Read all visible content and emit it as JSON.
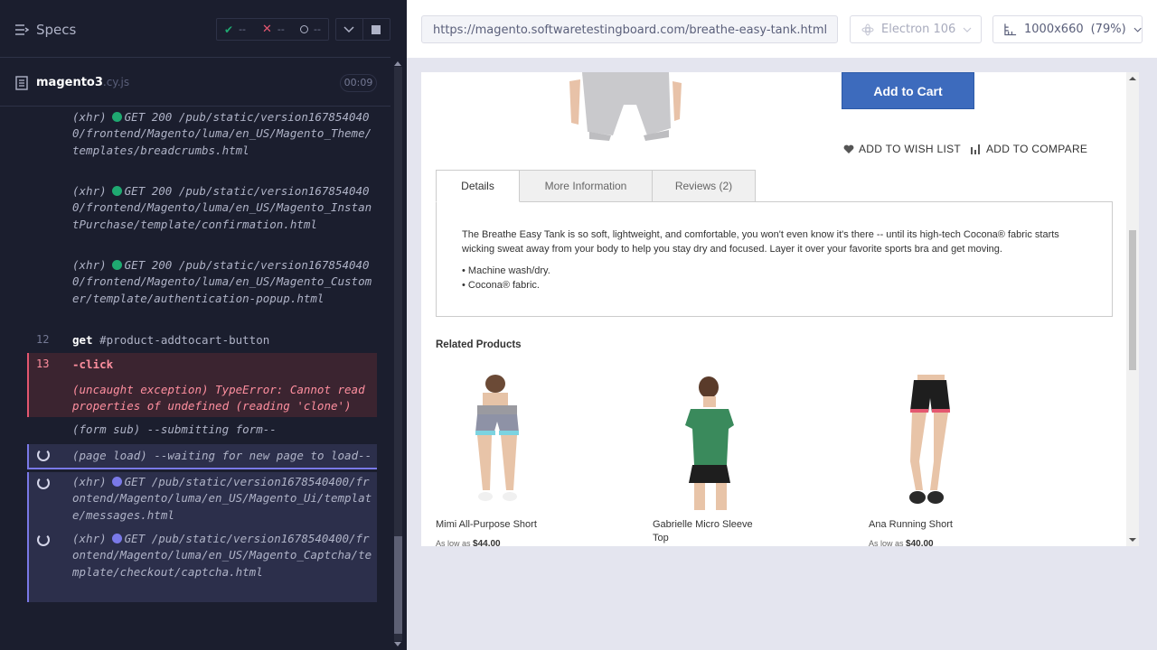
{
  "reporter": {
    "specs_label": "Specs",
    "stats": {
      "passed": "--",
      "failed": "--",
      "pending": "--"
    },
    "spec_file": {
      "name": "magento3",
      "ext": ".cy.js",
      "duration": "00:09"
    },
    "commands": [
      {
        "type": "(xhr)",
        "method": "GET 200",
        "url": "/pub/static/version1678540400/frontend/Magento/luma/en_US/Magento_Theme/templates/breadcrumbs.html"
      },
      {
        "type": "(xhr)",
        "method": "GET 200",
        "url": "/pub/static/version1678540400/frontend/Magento/luma/en_US/Magento_InstantPurchase/template/confirmation.html"
      },
      {
        "type": "(xhr)",
        "method": "GET 200",
        "url": "/pub/static/version1678540400/frontend/Magento/luma/en_US/Magento_Customer/template/authentication-popup.html"
      },
      {
        "num": "12",
        "name": "get",
        "msg": "#product-addtocart-button"
      },
      {
        "num": "13",
        "name": "-click",
        "msg": ""
      },
      {
        "type": "(uncaught exception)",
        "msg": "TypeError: Cannot read properties of undefined (reading 'clone')"
      },
      {
        "type": "(form sub)",
        "msg": "--submitting form--"
      },
      {
        "type": "(page load)",
        "msg": "--waiting for new page to load--"
      },
      {
        "type": "(xhr)",
        "method": "GET",
        "url": "/pub/static/version1678540400/frontend/Magento/luma/en_US/Magento_Ui/template/messages.html"
      },
      {
        "type": "(xhr)",
        "method": "GET",
        "url": "/pub/static/version1678540400/frontend/Magento/luma/en_US/Magento_Captcha/template/checkout/captcha.html"
      }
    ]
  },
  "aut": {
    "url": "https://magento.softwaretestingboard.com/breathe-easy-tank.html",
    "browser": "Electron 106",
    "viewport": "1000x660",
    "zoom": "(79%)"
  },
  "page": {
    "add_to_cart": "Add to Cart",
    "wish_list": "ADD TO WISH LIST",
    "compare": "ADD TO COMPARE",
    "tabs": [
      "Details",
      "More Information",
      "Reviews (2)"
    ],
    "description": "The Breathe Easy Tank is so soft, lightweight, and comfortable, you won't even know it's there -- until its high-tech Cocona® fabric starts wicking sweat away from your body to help you stay dry and focused. Layer it over your favorite sports bra and get moving.",
    "bullets": [
      "• Machine wash/dry.",
      "• Cocona® fabric."
    ],
    "related_title": "Related Products",
    "related": [
      {
        "name": "Mimi All-Purpose Short",
        "price_prefix": "As low as",
        "price": "$44.00"
      },
      {
        "name": "Gabrielle Micro Sleeve Top",
        "price_prefix": "",
        "price": ""
      },
      {
        "name": "Ana Running Short",
        "price_prefix": "As low as",
        "price": "$40.00"
      }
    ]
  },
  "colors": {
    "passed": "#1fa971",
    "failed": "#e45770",
    "pending_dot": "#7a79e8",
    "accent_button": "#3d6bbd"
  }
}
